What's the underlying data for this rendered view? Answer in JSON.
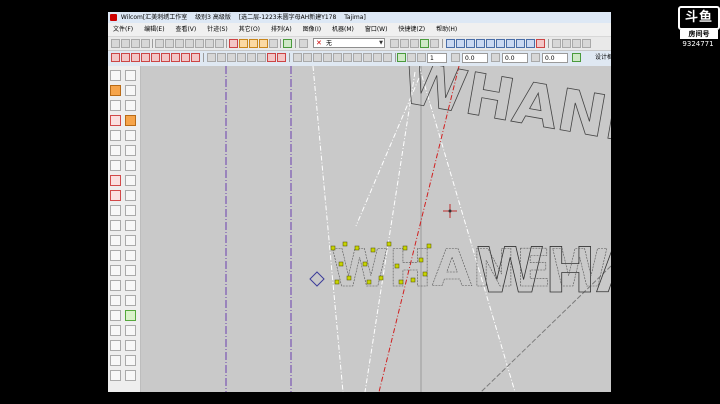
{
  "window": {
    "title_parts": [
      "Wilcom[汇美刺绣工作室",
      "级别3 高级版",
      "[选二层-1223未圆字母AH新建Y178",
      "Tajima]"
    ]
  },
  "menu": {
    "items": [
      "文件(F)",
      "编辑(E)",
      "查看(V)",
      "针迹(S)",
      "其它(O)",
      "排列(A)",
      "图像(I)",
      "机器(M)",
      "窗口(W)",
      "快捷键(Z)",
      "帮助(H)"
    ]
  },
  "toolbar": {
    "stitch_type_value": "无",
    "right_label": "设计框",
    "fields": [
      "1",
      "0.0",
      "0.0",
      "0.0"
    ]
  },
  "canvas": {
    "design_text": "WHANEW"
  },
  "watermark": {
    "logo": "斗鱼",
    "label": "房间号",
    "room_id": "9324771"
  },
  "colors": {
    "guide_purple": "#6a3fb0",
    "guide_red": "#d02020",
    "stitch_outline": "#333333",
    "select_node": "#c8d400"
  },
  "icons": [
    "select-arrow-icon",
    "reshape-icon",
    "pen-icon",
    "zigzag-icon",
    "circle-icon",
    "gear-icon",
    "needle-icon",
    "crosshair-cursor-icon",
    "dropdown-arrow-icon"
  ]
}
